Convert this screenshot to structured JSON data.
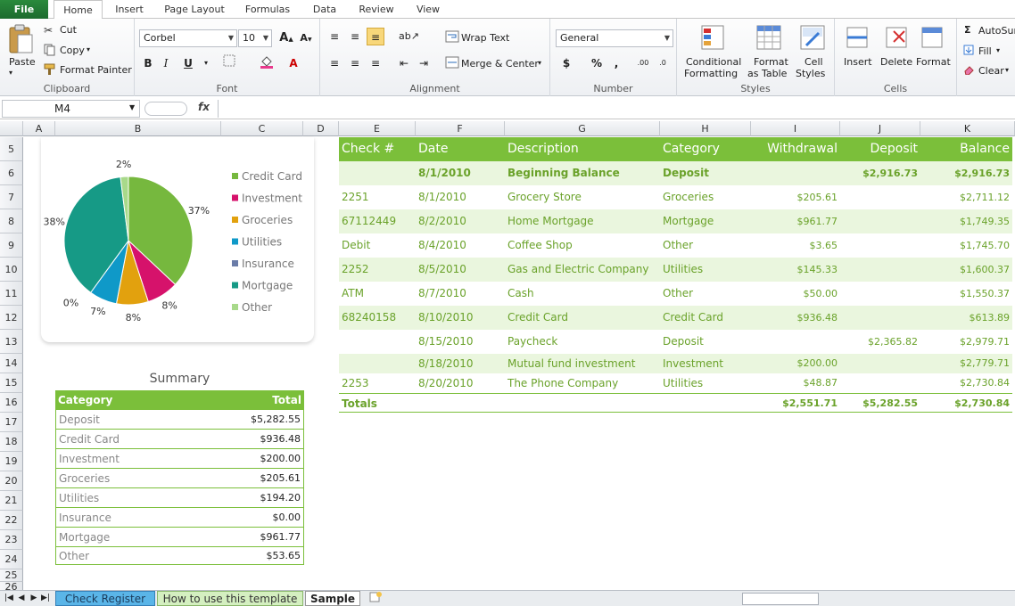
{
  "ribbon_tabs": [
    "File",
    "Home",
    "Insert",
    "Page Layout",
    "Formulas",
    "Data",
    "Review",
    "View"
  ],
  "clipboard": {
    "paste": "Paste",
    "cut": "Cut",
    "copy": "Copy",
    "format_painter": "Format Painter",
    "label": "Clipboard"
  },
  "font": {
    "name": "Corbel",
    "size": "10",
    "label": "Font",
    "bold": "B",
    "italic": "I",
    "underline": "U"
  },
  "alignment": {
    "wrap": "Wrap Text",
    "merge": "Merge & Center",
    "label": "Alignment"
  },
  "number": {
    "format": "General",
    "currency": "$",
    "percent": "%",
    "comma": ",",
    "label": "Number"
  },
  "styles": {
    "conditional": "Conditional",
    "conditional2": "Formatting",
    "format_as": "Format",
    "format_as2": "as Table",
    "cell_styles": "Cell",
    "cell_styles2": "Styles",
    "label": "Styles"
  },
  "cells": {
    "insert": "Insert",
    "delete": "Delete",
    "format": "Format",
    "label": "Cells"
  },
  "editing": {
    "autosum": "AutoSum",
    "fill": "Fill",
    "clear": "Clear"
  },
  "formula_bar": {
    "name_box": "M4",
    "fx": "fx",
    "value": ""
  },
  "columns": [
    "A",
    "B",
    "C",
    "D",
    "E",
    "F",
    "G",
    "H",
    "I",
    "J",
    "K"
  ],
  "rows": [
    "5",
    "6",
    "7",
    "8",
    "9",
    "10",
    "11",
    "12",
    "13",
    "14",
    "15",
    "16",
    "17",
    "18",
    "19",
    "20",
    "21",
    "22",
    "23",
    "24",
    "25",
    "26"
  ],
  "chart_data": {
    "type": "pie",
    "labels": [
      "Credit Card",
      "Investment",
      "Groceries",
      "Utilities",
      "Insurance",
      "Mortgage",
      "Other"
    ],
    "values": [
      37,
      8,
      8,
      7,
      0,
      38,
      2
    ],
    "data_labels": [
      "37%",
      "8%",
      "8%",
      "7%",
      "0%",
      "38%",
      "2%"
    ],
    "colors": [
      "#76b83e",
      "#d6126b",
      "#e2a10e",
      "#0f99c8",
      "#6a7ca8",
      "#169a86",
      "#a8d98a"
    ],
    "legend": "right"
  },
  "register": {
    "headers": [
      "Check #",
      "Date",
      "Description",
      "Category",
      "Withdrawal",
      "Deposit",
      "Balance"
    ],
    "rows": [
      [
        "",
        "8/1/2010",
        "Beginning Balance",
        "Deposit",
        "",
        "$2,916.73",
        "$2,916.73"
      ],
      [
        "2251",
        "8/1/2010",
        "Grocery Store",
        "Groceries",
        "$205.61",
        "",
        "$2,711.12"
      ],
      [
        "67112449",
        "8/2/2010",
        "Home Mortgage",
        "Mortgage",
        "$961.77",
        "",
        "$1,749.35"
      ],
      [
        "Debit",
        "8/4/2010",
        "Coffee Shop",
        "Other",
        "$3.65",
        "",
        "$1,745.70"
      ],
      [
        "2252",
        "8/5/2010",
        "Gas and Electric Company",
        "Utilities",
        "$145.33",
        "",
        "$1,600.37"
      ],
      [
        "ATM",
        "8/7/2010",
        "Cash",
        "Other",
        "$50.00",
        "",
        "$1,550.37"
      ],
      [
        "68240158",
        "8/10/2010",
        "Credit Card",
        "Credit Card",
        "$936.48",
        "",
        "$613.89"
      ],
      [
        "",
        "8/15/2010",
        "Paycheck",
        "Deposit",
        "",
        "$2,365.82",
        "$2,979.71"
      ],
      [
        "",
        "8/18/2010",
        "Mutual fund investment",
        "Investment",
        "$200.00",
        "",
        "$2,779.71"
      ],
      [
        "2253",
        "8/20/2010",
        "The Phone Company",
        "Utilities",
        "$48.87",
        "",
        "$2,730.84"
      ]
    ],
    "totals": [
      "Totals",
      "",
      "",
      "",
      "$2,551.71",
      "$5,282.55",
      "$2,730.84"
    ]
  },
  "summary": {
    "title": "Summary",
    "headers": [
      "Category",
      "Total"
    ],
    "rows": [
      [
        "Deposit",
        "$5,282.55"
      ],
      [
        "Credit Card",
        "$936.48"
      ],
      [
        "Investment",
        "$200.00"
      ],
      [
        "Groceries",
        "$205.61"
      ],
      [
        "Utilities",
        "$194.20"
      ],
      [
        "Insurance",
        "$0.00"
      ],
      [
        "Mortgage",
        "$961.77"
      ],
      [
        "Other",
        "$53.65"
      ]
    ]
  },
  "sheet_tabs": [
    "Check Register",
    "How to use this template",
    "Sample"
  ],
  "colors": {
    "green": "#7bbf3a",
    "text_green": "#6aa22a",
    "band": "#eaf6de"
  }
}
